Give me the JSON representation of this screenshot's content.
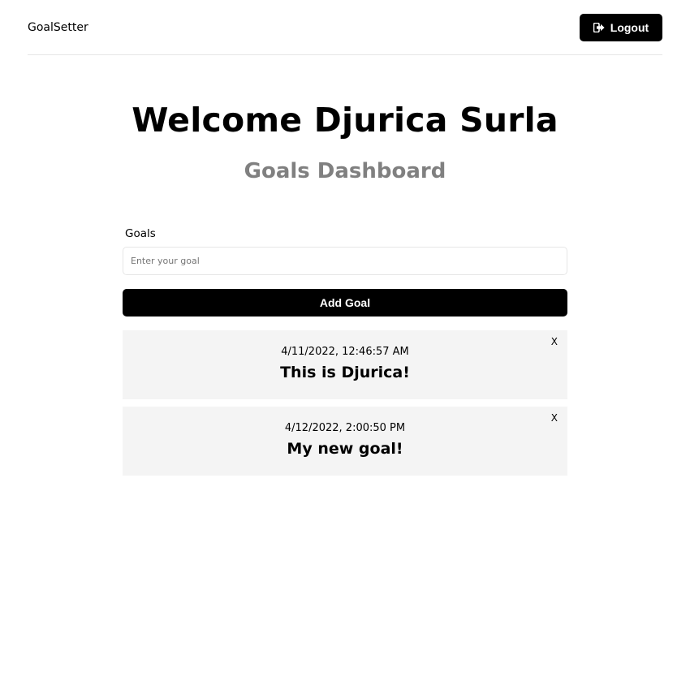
{
  "header": {
    "logo": "GoalSetter",
    "logout_label": "Logout",
    "logout_icon": "sign-out-icon"
  },
  "main": {
    "heading": "Welcome Djurica Surla",
    "subheading": "Goals Dashboard"
  },
  "form": {
    "label": "Goals",
    "placeholder": "Enter your goal",
    "value": "",
    "submit_label": "Add Goal"
  },
  "goals": [
    {
      "date": "4/11/2022, 12:46:57 AM",
      "text": "This is Djurica!",
      "close_label": "X"
    },
    {
      "date": "4/12/2022, 2:00:50 PM",
      "text": "My new goal!",
      "close_label": "X"
    }
  ],
  "colors": {
    "primary": "#000000",
    "subheading": "#808080",
    "card_bg": "#f4f4f4",
    "border": "#e6e6e6"
  }
}
